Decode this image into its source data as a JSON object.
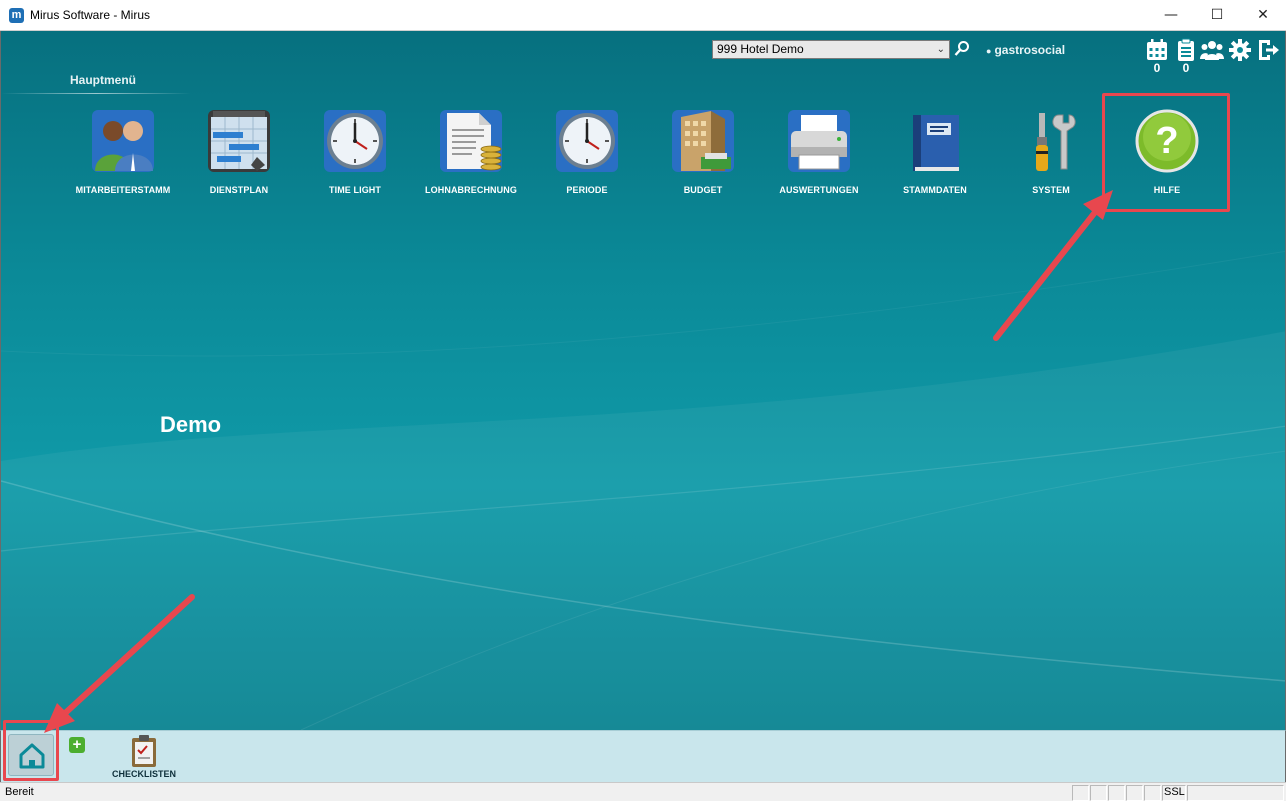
{
  "window": {
    "title": "Mirus Software - Mirus",
    "app_icon_letter": "m",
    "minimize_symbol": "—",
    "maximize_symbol": "☐",
    "close_symbol": "✕"
  },
  "header": {
    "hotel_selected": "999 Hotel Demo",
    "username": "gastrosocial",
    "calendar_count": "0",
    "clipboard_count": "0",
    "icons": [
      "calendar-icon",
      "clipboard-icon",
      "group-icon",
      "gear-icon",
      "logout-icon"
    ]
  },
  "menu": {
    "title": "Hauptmenü",
    "tiles": [
      {
        "label": "MITARBEITERSTAMM",
        "icon": "employees-icon"
      },
      {
        "label": "DIENSTPLAN",
        "icon": "schedule-icon"
      },
      {
        "label": "TIME LIGHT",
        "icon": "clock-icon"
      },
      {
        "label": "LOHNABRECHNUNG",
        "icon": "payroll-icon"
      },
      {
        "label": "PERIODE",
        "icon": "clock-icon"
      },
      {
        "label": "BUDGET",
        "icon": "budget-icon"
      },
      {
        "label": "AUSWERTUNGEN",
        "icon": "printer-icon"
      },
      {
        "label": "STAMMDATEN",
        "icon": "book-icon"
      },
      {
        "label": "SYSTEM",
        "icon": "tools-icon"
      },
      {
        "label": "HILFE",
        "icon": "help-icon"
      }
    ]
  },
  "main": {
    "demo_label": "Demo"
  },
  "bottom": {
    "add_symbol": "+",
    "checklist_label": "CHECKLISTEN"
  },
  "status": {
    "text": "Bereit",
    "ssl": "SSL"
  },
  "colors": {
    "teal_dark": "#07707f",
    "teal_light": "#109aa8",
    "annotation_red": "#e8474e",
    "bottom_bar": "#c9e6ec"
  }
}
